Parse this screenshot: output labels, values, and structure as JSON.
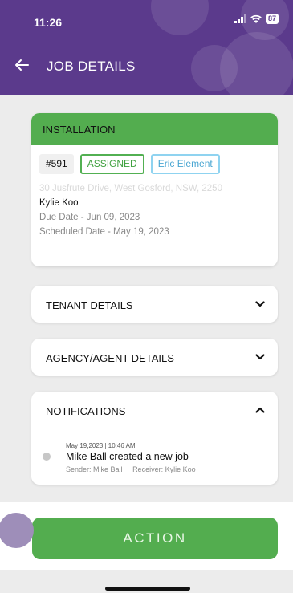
{
  "status_bar": {
    "time": "11:26",
    "battery": "87"
  },
  "header": {
    "title": "JOB DETAILS",
    "back_icon": "arrow-left-icon"
  },
  "job": {
    "type": "INSTALLATION",
    "id": "#591",
    "status": "ASSIGNED",
    "assignee": "Eric Element",
    "address": "30 Jusfrute Drive, West Gosford, NSW, 2250",
    "tenant_name": "Kylie Koo",
    "due_date": "Due Date - Jun 09, 2023",
    "scheduled_date": "Scheduled Date - May 19, 2023"
  },
  "sections": {
    "tenant": "TENANT DETAILS",
    "agency": "AGENCY/AGENT DETAILS",
    "notifications": "NOTIFICATIONS"
  },
  "notification": {
    "meta": "May 19,2023 | 10:46 AM",
    "text": "Mike Ball created a new job",
    "sender": "Sender: Mike Ball",
    "receiver": "Receiver: Kylie Koo"
  },
  "action_label": "ACTION",
  "colors": {
    "header": "#5b3a8c",
    "accent_green": "#53ad4f",
    "assignee_blue": "#8fd3f0"
  }
}
